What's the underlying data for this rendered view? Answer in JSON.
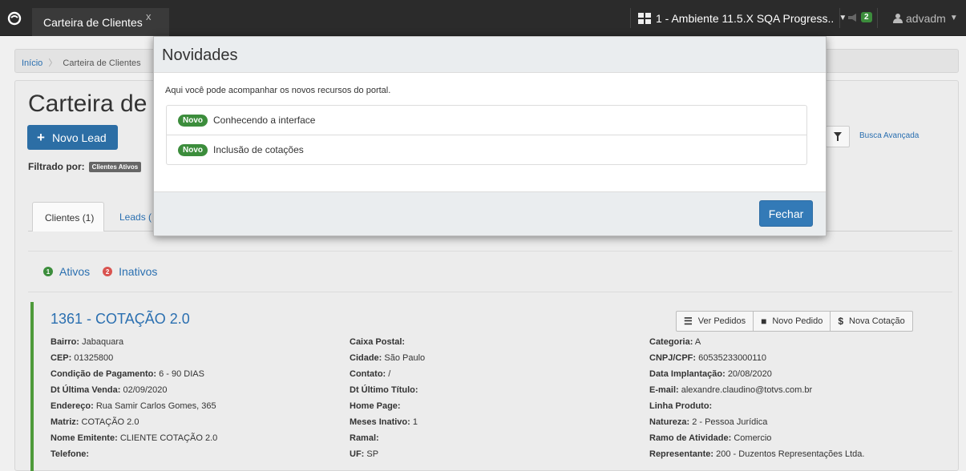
{
  "topbar": {
    "tab_label": "Carteira de Clientes",
    "tab_close": "x",
    "environment": "1 - Ambiente 11.5.X SQA Progress..",
    "notifications_count": "2",
    "user": "advadm"
  },
  "breadcrumb": {
    "home": "Início",
    "current": "Carteira de Clientes"
  },
  "page": {
    "title": "Carteira de C",
    "new_lead_label": "Novo Lead",
    "filter_label": "Filtrado por:",
    "filter_tag": "Clientes Ativos",
    "advanced_search": "Busca Avançada",
    "tab_clientes": "Clientes (1)",
    "tab_leads": "Leads (",
    "status_ativos_count": "1",
    "status_ativos": "Ativos",
    "status_inativos_count": "2",
    "status_inativos": "Inativos"
  },
  "card": {
    "title": "1361 - COTAÇÃO 2.0",
    "actions": {
      "ver_pedidos": "Ver Pedidos",
      "novo_pedido": "Novo Pedido",
      "nova_cotacao": "Nova Cotação"
    },
    "col1": [
      {
        "label": "Bairro:",
        "value": "Jabaquara"
      },
      {
        "label": "CEP:",
        "value": "01325800"
      },
      {
        "label": "Condição de Pagamento:",
        "value": "6 - 90 DIAS"
      },
      {
        "label": "Dt Última Venda:",
        "value": "02/09/2020"
      },
      {
        "label": "Endereço:",
        "value": "Rua Samir Carlos Gomes, 365"
      },
      {
        "label": "Matriz:",
        "value": "COTAÇÃO 2.0"
      },
      {
        "label": "Nome Emitente:",
        "value": "CLIENTE COTAÇÃO 2.0"
      },
      {
        "label": "Telefone:",
        "value": ""
      }
    ],
    "col2": [
      {
        "label": "Caixa Postal:",
        "value": ""
      },
      {
        "label": "Cidade:",
        "value": "São Paulo"
      },
      {
        "label": "Contato:",
        "value": "/"
      },
      {
        "label": "Dt Último Título:",
        "value": ""
      },
      {
        "label": "Home Page:",
        "value": ""
      },
      {
        "label": "Meses Inativo:",
        "value": "1"
      },
      {
        "label": "Ramal:",
        "value": ""
      },
      {
        "label": "UF:",
        "value": "SP"
      }
    ],
    "col3": [
      {
        "label": "Categoria:",
        "value": "A"
      },
      {
        "label": "CNPJ/CPF:",
        "value": "60535233000110"
      },
      {
        "label": "Data Implantação:",
        "value": "20/08/2020"
      },
      {
        "label": "E-mail:",
        "value": "alexandre.claudino@totvs.com.br"
      },
      {
        "label": "Linha Produto:",
        "value": ""
      },
      {
        "label": "Natureza:",
        "value": "2 - Pessoa Jurídica"
      },
      {
        "label": "Ramo de Atividade:",
        "value": "Comercio"
      },
      {
        "label": "Representante:",
        "value": "200 - Duzentos Representações Ltda."
      }
    ]
  },
  "modal": {
    "title": "Novidades",
    "intro": "Aqui você pode acompanhar os novos recursos do portal.",
    "items": [
      {
        "badge": "Novo",
        "label": "Conhecendo a interface"
      },
      {
        "badge": "Novo",
        "label": "Inclusão de cotações"
      }
    ],
    "close_label": "Fechar"
  },
  "colors": {
    "navbar": "#2b2b2b",
    "primary": "#337ab7",
    "success": "#3c8d3c",
    "danger": "#d9534f",
    "link": "#2a6fb0"
  }
}
